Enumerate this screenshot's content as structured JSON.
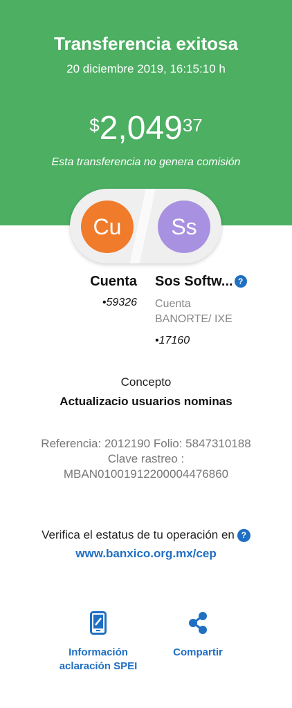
{
  "header": {
    "title": "Transferencia exitosa",
    "datetime": "20 diciembre 2019, 16:15:10 h",
    "amount_symbol": "$",
    "amount_integer": "2,049",
    "amount_decimal": "37",
    "commission_note": "Esta transferencia no genera comisión"
  },
  "origin": {
    "initials": "Cu",
    "name": "Cuenta",
    "account": "•59326",
    "color": "#f07b2b"
  },
  "destination": {
    "initials": "Ss",
    "name": "Sos Softw...",
    "type": "Cuenta",
    "bank": "BANORTE/ IXE",
    "account": "•17160",
    "color": "#a891e0"
  },
  "concept": {
    "label": "Concepto",
    "value": "Actualizacio usuarios nominas"
  },
  "reference": {
    "line1": "Referencia: 2012190 Folio: 5847310188",
    "line2": "Clave rastreo :",
    "line3": "MBAN01001912200004476860"
  },
  "verify": {
    "text": "Verifica el estatus de tu operación en",
    "link": "www.banxico.org.mx/cep"
  },
  "actions": {
    "spei_line1": "Información",
    "spei_line2": "aclaración SPEI",
    "share": "Compartir"
  },
  "help_glyph": "?",
  "colors": {
    "header_bg": "#4caf62",
    "accent_blue": "#1f6fc2"
  }
}
